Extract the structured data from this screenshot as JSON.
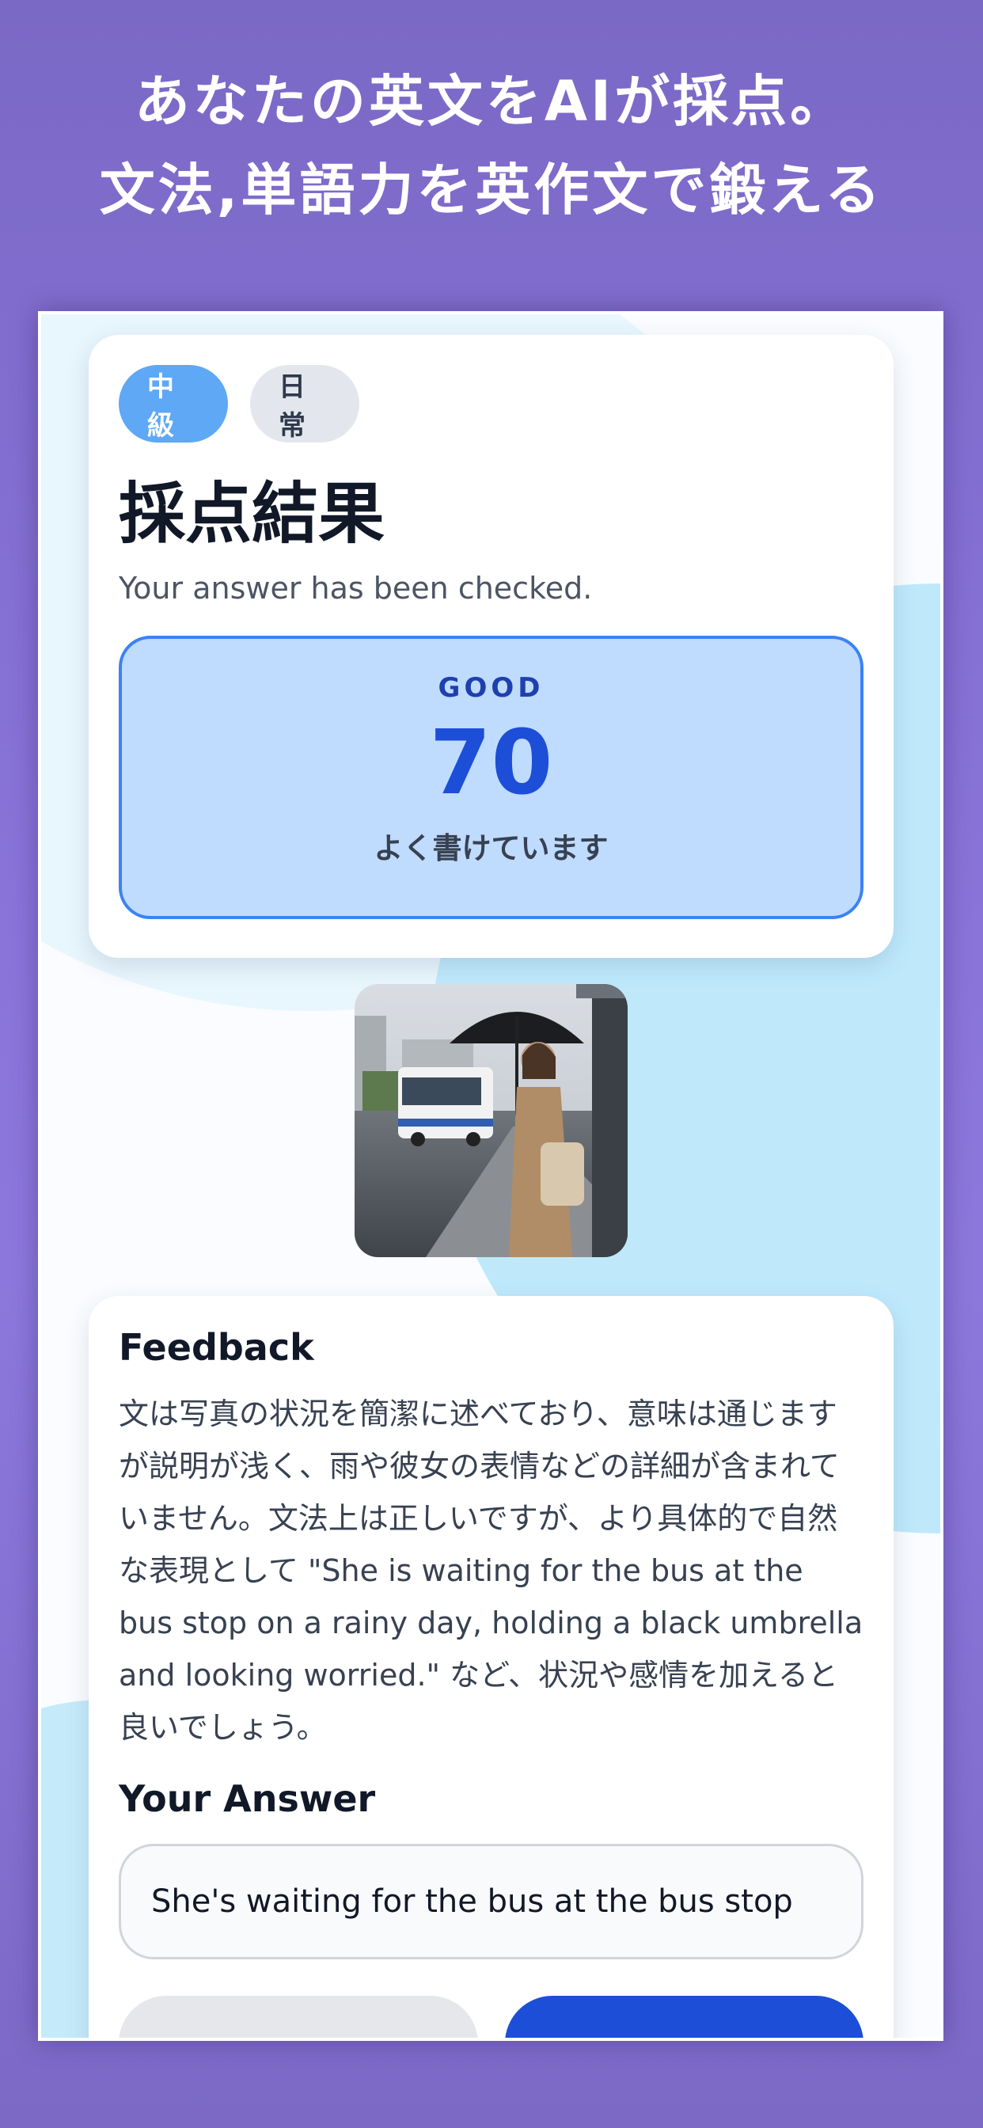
{
  "promo": {
    "line1": "あなたの英文をAIが採点。",
    "line2": "文法,単語力を英作文で鍛える"
  },
  "result": {
    "tags": {
      "level": "中級",
      "topic": "日常"
    },
    "title": "採点結果",
    "subtitle": "Your answer has been checked.",
    "grade": "GOOD",
    "score": "70",
    "comment": "よく書けています"
  },
  "photo": {
    "alt": "Woman with black umbrella waiting at a rainy bus stop"
  },
  "feedback": {
    "heading": "Feedback",
    "text": "文は写真の状況を簡潔に述べており、意味は通じますが説明が浅く、雨や彼女の表情などの詳細が含まれていません。文法上は正しいですが、より具体的で自然な表現として \"She is waiting for the bus at the bus stop on a rainy day, holding a black umbrella and looking worried.\" など、状況や感情を加えると良いでしょう。"
  },
  "answer": {
    "heading": "Your Answer",
    "value": "She's waiting for the bus at the bus stop"
  },
  "colors": {
    "background": "#8a74da",
    "accent": "#1d4ed8",
    "score_box": "#bfdbfe",
    "level_chip": "#5ea8f5"
  }
}
